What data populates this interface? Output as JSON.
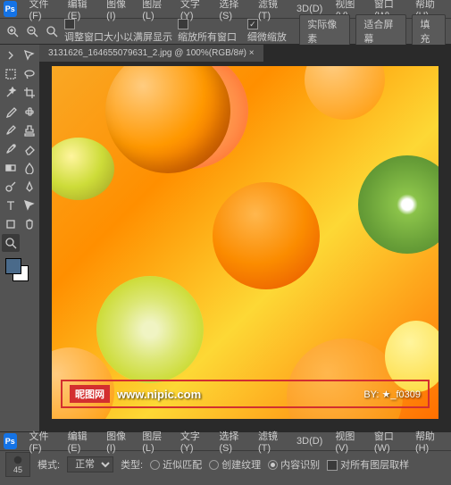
{
  "menu": {
    "file": "文件(F)",
    "edit": "编辑(E)",
    "image": "图像(I)",
    "layer": "图层(L)",
    "type": "文字(Y)",
    "select": "选择(S)",
    "filter": "滤镜(T)",
    "3d": "3D(D)",
    "view": "视图(V)",
    "window": "窗口(W)",
    "help": "帮助(H)"
  },
  "optbar": {
    "resize_window": "调整窗口大小以满屏显示",
    "zoom_all": "缩放所有窗口",
    "scrubby": "细微缩放",
    "actual": "实际像素",
    "fit": "适合屏幕",
    "fill": "填充"
  },
  "doc": {
    "tab": "3131626_164655079631_2.jpg @ 100%(RGB/8#) ×"
  },
  "watermark": {
    "badge": "昵图网",
    "url": "www.nipic.com",
    "by": "BY: ★_f0309"
  },
  "bottom": {
    "mode_label": "模式:",
    "mode_value": "正常",
    "type_label": "类型:",
    "proximity": "近似匹配",
    "create_texture": "创建纹理",
    "content_aware": "内容识别",
    "sample_all": "对所有图层取样",
    "brush_size": "45"
  }
}
